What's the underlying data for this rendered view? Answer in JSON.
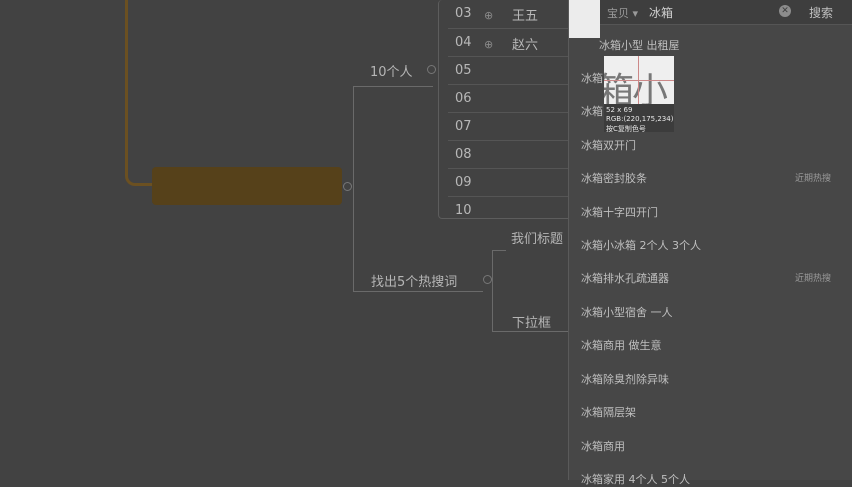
{
  "mindmap": {
    "branch_people": "10个人",
    "branch_hot": "找出5个热搜词",
    "sub_title": "我们标题",
    "sub_dropdown": "下拉框",
    "rows": [
      {
        "num": "03",
        "name": "王五"
      },
      {
        "num": "04",
        "name": "赵六"
      },
      {
        "num": "05",
        "name": ""
      },
      {
        "num": "06",
        "name": ""
      },
      {
        "num": "07",
        "name": ""
      },
      {
        "num": "08",
        "name": ""
      },
      {
        "num": "09",
        "name": ""
      },
      {
        "num": "10",
        "name": ""
      }
    ]
  },
  "search": {
    "scope": "宝贝",
    "query": "冰箱",
    "button": "搜索",
    "suggestions": [
      {
        "text": "冰箱小型 出租屋",
        "tag": ""
      },
      {
        "text": "冰箱",
        "tag": ""
      },
      {
        "text": "冰箱",
        "tag": ""
      },
      {
        "text": "冰箱双开门",
        "tag": ""
      },
      {
        "text": "冰箱密封胶条",
        "tag": "近期热搜"
      },
      {
        "text": "冰箱十字四开门",
        "tag": ""
      },
      {
        "text": "冰箱小冰箱 2个人 3个人",
        "tag": ""
      },
      {
        "text": "冰箱排水孔疏通器",
        "tag": "近期热搜"
      },
      {
        "text": "冰箱小型宿舍 一人",
        "tag": ""
      },
      {
        "text": "冰箱商用 做生意",
        "tag": ""
      },
      {
        "text": "冰箱除臭剂除异味",
        "tag": ""
      },
      {
        "text": "冰箱隔层架",
        "tag": ""
      },
      {
        "text": "冰箱商用",
        "tag": ""
      },
      {
        "text": "冰箱家用 4个人 5个人",
        "tag": ""
      }
    ]
  },
  "magnifier": {
    "glyphs": "箱小",
    "size": "52 x 69",
    "rgb": "RGB:(220,175,234)",
    "hint": "按C复制色号"
  }
}
